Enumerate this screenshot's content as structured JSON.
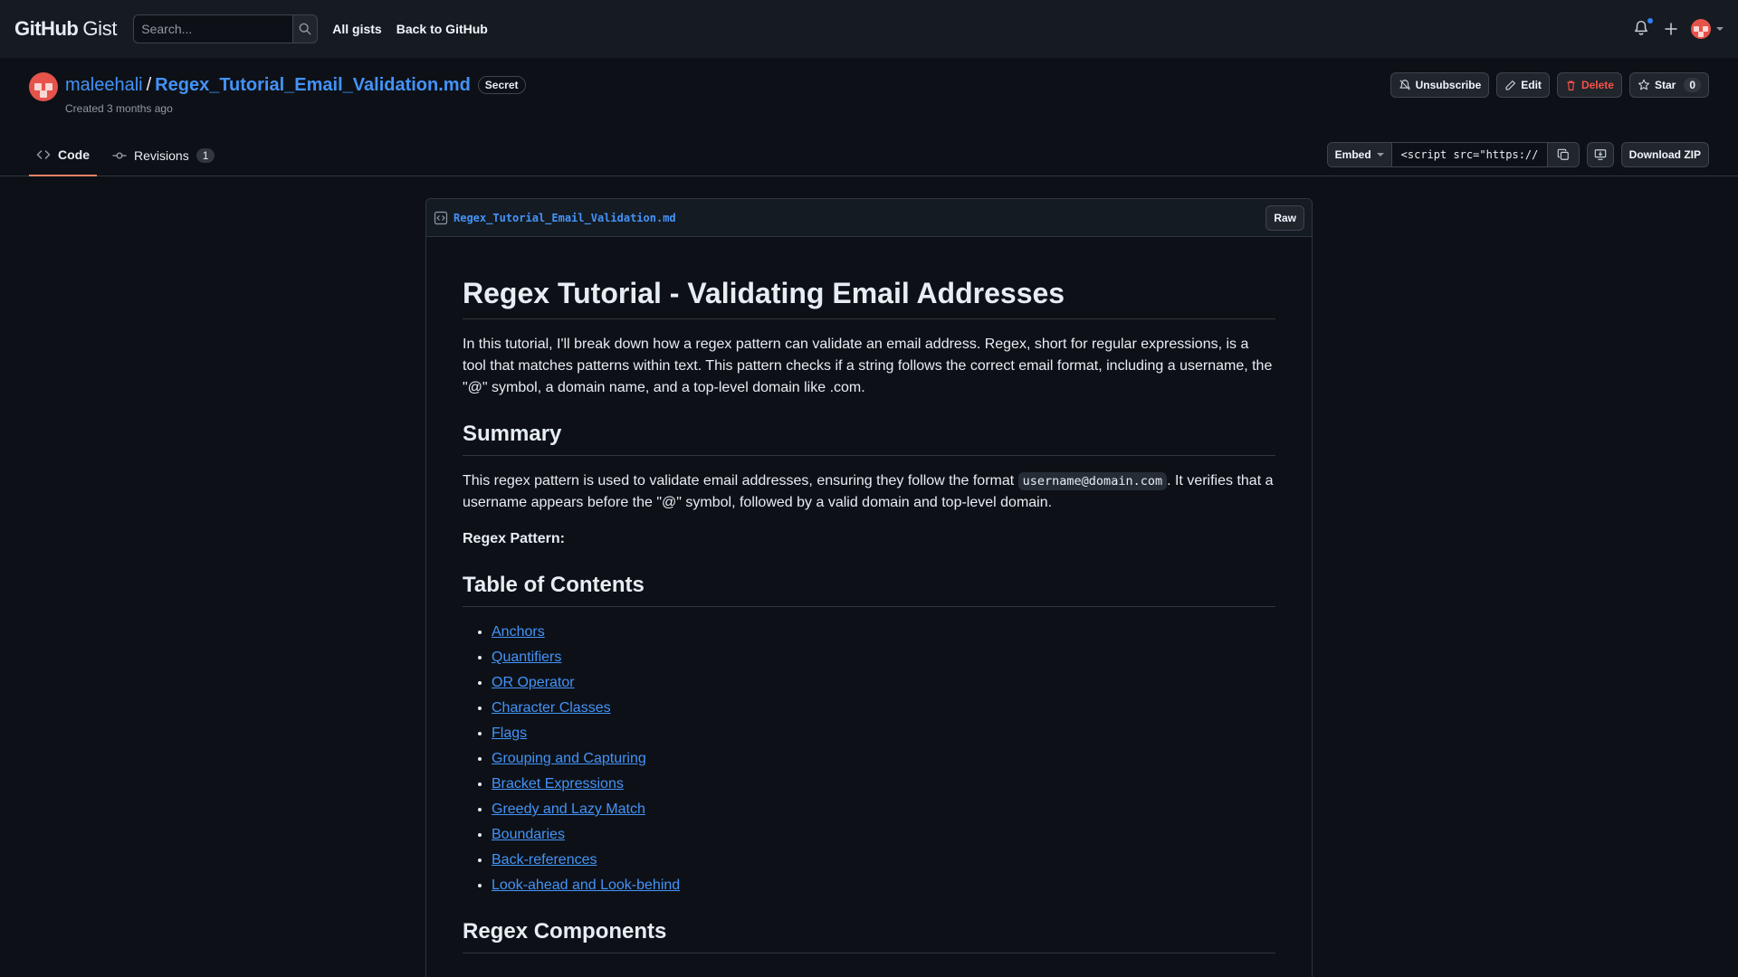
{
  "topbar": {
    "logo_primary": "GitHub",
    "logo_secondary": "Gist",
    "search_placeholder": "Search...",
    "links": [
      "All gists",
      "Back to GitHub"
    ]
  },
  "gist": {
    "owner": "maleehali",
    "filename": "Regex_Tutorial_Email_Validation.md",
    "visibility": "Secret",
    "created": "Created 3 months ago",
    "actions": {
      "unsubscribe": "Unsubscribe",
      "edit": "Edit",
      "delete": "Delete",
      "star": "Star",
      "star_count": "0"
    }
  },
  "tabs": {
    "code": "Code",
    "revisions": "Revisions",
    "revisions_count": "1"
  },
  "embed": {
    "label": "Embed",
    "value": "<script src=\"https://",
    "download": "Download ZIP"
  },
  "file": {
    "name": "Regex_Tutorial_Email_Validation.md",
    "raw": "Raw"
  },
  "content": {
    "h1": "Regex Tutorial - Validating Email Addresses",
    "intro": "In this tutorial, I'll break down how a regex pattern can validate an email address. Regex, short for regular expressions, is a tool that matches patterns within text. This pattern checks if a string follows the correct email format, including a username, the \"@\" symbol, a domain name, and a top-level domain like .com.",
    "summary_heading": "Summary",
    "summary_before": "This regex pattern is used to validate email addresses, ensuring they follow the format ",
    "summary_code": "username@domain.com",
    "summary_after": ". It verifies that a username appears before the \"@\" symbol, followed by a valid domain and top-level domain.",
    "pattern_label": "Regex Pattern:",
    "toc_heading": "Table of Contents",
    "toc": [
      "Anchors",
      "Quantifiers",
      "OR Operator",
      "Character Classes",
      "Flags",
      "Grouping and Capturing",
      "Bracket Expressions",
      "Greedy and Lazy Match",
      "Boundaries",
      "Back-references",
      "Look-ahead and Look-behind"
    ],
    "components_heading": "Regex Components"
  },
  "colors": {
    "background": "#0d1117",
    "header": "#161b22",
    "link": "#4493f8",
    "danger": "#f85149",
    "tab_underline": "#f78166"
  }
}
